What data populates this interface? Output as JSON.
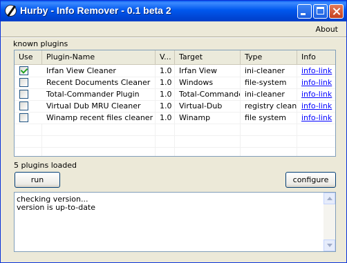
{
  "window": {
    "title": "Hurby - Info Remover - 0.1 beta 2"
  },
  "menu": {
    "about": "About"
  },
  "plugins": {
    "label": "known plugins",
    "columns": [
      "Use",
      "Plugin-Name",
      "V...",
      "Target",
      "Type",
      "Info"
    ],
    "rows": [
      {
        "checked": true,
        "name": "Irfan View Cleaner",
        "version": "1.0",
        "target": "Irfan View",
        "type": "ini-cleaner",
        "info": "info-link"
      },
      {
        "checked": false,
        "name": "Recent Documents Cleaner",
        "version": "1.0",
        "target": "Windows",
        "type": "file-system",
        "info": "info-link"
      },
      {
        "checked": false,
        "name": "Total-Commander Plugin",
        "version": "1.0",
        "target": "Total-Commander",
        "type": "ini-cleaner",
        "info": "info-link"
      },
      {
        "checked": false,
        "name": "Virtual Dub MRU Cleaner",
        "version": "1.0",
        "target": "Virtual-Dub",
        "type": "registry cleaner",
        "info": "info-link"
      },
      {
        "checked": false,
        "name": "Winamp recent files cleaner",
        "version": "1.0",
        "target": "Winamp",
        "type": "file system",
        "info": "info-link"
      }
    ]
  },
  "status": {
    "loaded": "5 plugins loaded"
  },
  "buttons": {
    "run": "run",
    "configure": "configure"
  },
  "log": {
    "lines": [
      "checking version...",
      "version is up-to-date"
    ]
  }
}
